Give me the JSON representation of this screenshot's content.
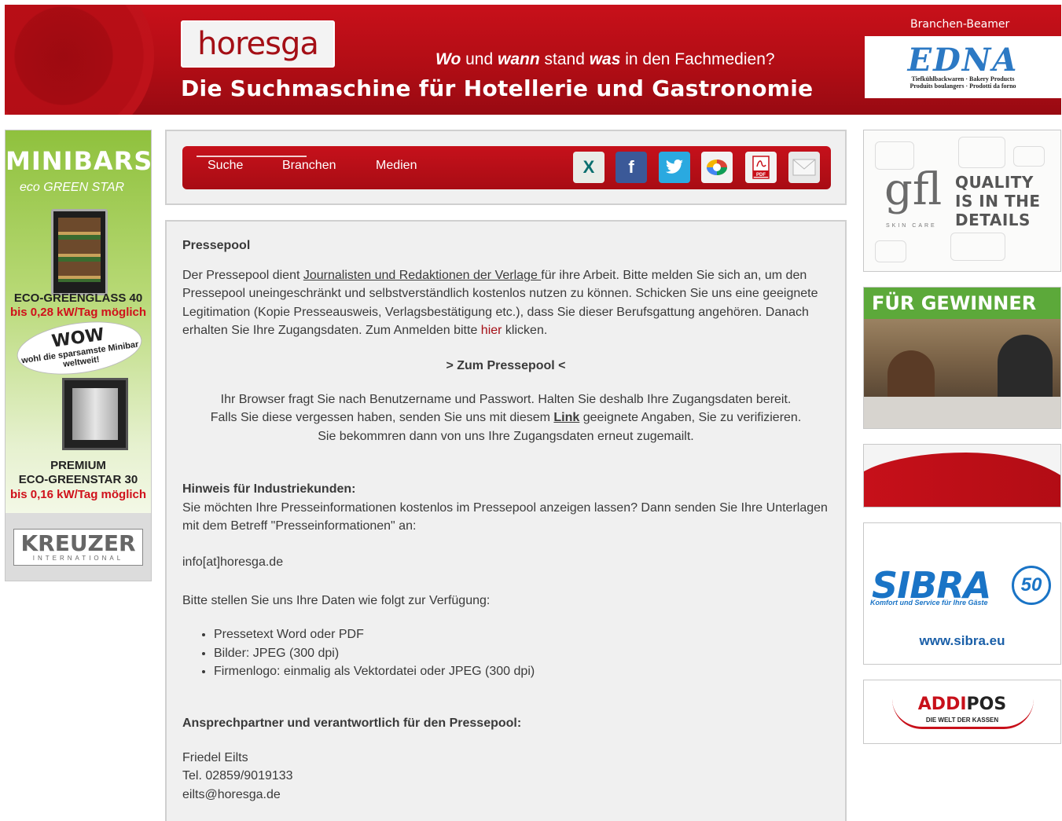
{
  "header": {
    "logo": "horesga",
    "slogan_line1_parts": [
      "Wo",
      " und ",
      "wann",
      " stand ",
      "was",
      " in den Fachmedien?"
    ],
    "slogan_line2": "Die Suchmaschine für Hotellerie und Gastronomie",
    "beamer_label": "Branchen-Beamer",
    "edna_logo": "EDNA",
    "edna_sub1": "Tiefkühlbackwaren · Bakery Products",
    "edna_sub2": "Produits boulangers · Prodotti da forno"
  },
  "ad_left": {
    "headline": "MINIBARS",
    "brand": "eco GREEN STAR",
    "product1": "ECO-GREENGLASS 40",
    "product1_sub": "bis 0,28 kW/Tag möglich",
    "wow": "WOW",
    "wow_sub": "wohl die sparsamste Minibar weltweit!",
    "product2_a": "PREMIUM",
    "product2_b": "ECO-GREENSTAR 30",
    "product2_sub": "bis 0,16 kW/Tag möglich",
    "maker": "KREUZER",
    "maker_sub": "INTERNATIONAL"
  },
  "nav": {
    "items": [
      "Suche",
      "Branchen",
      "Medien"
    ],
    "share_icons": [
      {
        "name": "xing-icon",
        "glyph": "X",
        "color": "#e9ece7",
        "fg": "#0a6e6e"
      },
      {
        "name": "facebook-icon",
        "glyph": "f",
        "color": "#3b5998",
        "fg": "#ffffff"
      },
      {
        "name": "twitter-icon",
        "glyph": "t",
        "color": "#2aa9e0",
        "fg": "#ffffff"
      },
      {
        "name": "google-buzz-icon",
        "glyph": "●",
        "color": "#f2f2f2",
        "fg": "#e8a020"
      },
      {
        "name": "pdf-icon",
        "glyph": "PDF",
        "color": "#f2f2f2",
        "fg": "#c8101a"
      },
      {
        "name": "mail-icon",
        "glyph": "✉",
        "color": "#e8e8e8",
        "fg": "#b5b5b5"
      }
    ]
  },
  "main": {
    "title": "Pressepool",
    "intro_before": "Der Pressepool dient ",
    "intro_link": "Journalisten und Redaktionen der Verlage ",
    "intro_after": " für ihre Arbeit. Bitte melden Sie sich an, um den Pressepool uneingeschränkt und selbstverständlich kostenlos nutzen zu können. Schicken Sie uns eine geeignete Legitimation (Kopie Presseausweis, Verlagsbestätigung etc.), dass Sie dieser Berufsgattung angehören. Danach erhalten Sie Ihre Zugangsdaten. Zum Anmelden bitte ",
    "intro_hier": "hier",
    "intro_end": " klicken.",
    "zum_pressepool": "> Zum Pressepool <",
    "browser_line1": "Ihr Browser fragt Sie nach Benutzername und Passwort. Halten Sie deshalb Ihre Zugangsdaten bereit.",
    "browser_line2_a": "Falls Sie diese vergessen haben, senden Sie uns mit diesem  ",
    "browser_line2_link": "Link",
    "browser_line2_b": " geeignete Angaben, Sie zu verifizieren.",
    "browser_line3": "Sie bekommren dann von uns Ihre Zugangsdaten erneut zugemailt.",
    "hinweis_title": "Hinweis für Industriekunden:",
    "hinweis_text": "Sie möchten Ihre Presseinformationen kostenlos im Pressepool anzeigen lassen? Dann senden Sie Ihre Unterlagen mit dem Betreff \"Presseinformationen\" an:",
    "info_email": "info[at]horesga.de",
    "bitte": "Bitte stellen Sie uns Ihre Daten wie folgt zur Verfügung:",
    "list": [
      "Pressetext Word oder PDF",
      "Bilder: JPEG (300 dpi)",
      "Firmenlogo: einmalig als Vektordatei oder JPEG (300 dpi)"
    ],
    "ansprech_title": "Ansprechpartner und verantwortlich für den Pressepool:",
    "contact_name": "Friedel Eilts",
    "contact_tel": "Tel. 02859/9019133",
    "contact_email": "eilts@horesga.de"
  },
  "ads_right": {
    "gfl_logo": "gfl",
    "gfl_sub": "SKIN CARE",
    "gfl_quality": "QUALITY",
    "gfl_is": "IS IN THE",
    "gfl_details": "DETAILS",
    "gewinner": "FÜR GEWINNER",
    "sibra": "SIBRA",
    "sibra_50": "50",
    "sibra_sub": "Komfort und Service für Ihre Gäste",
    "sibra_url": "www.sibra.eu",
    "addipos_a": "ADDI",
    "addipos_b": "POS",
    "addipos_sub": "DIE WELT DER KASSEN"
  }
}
